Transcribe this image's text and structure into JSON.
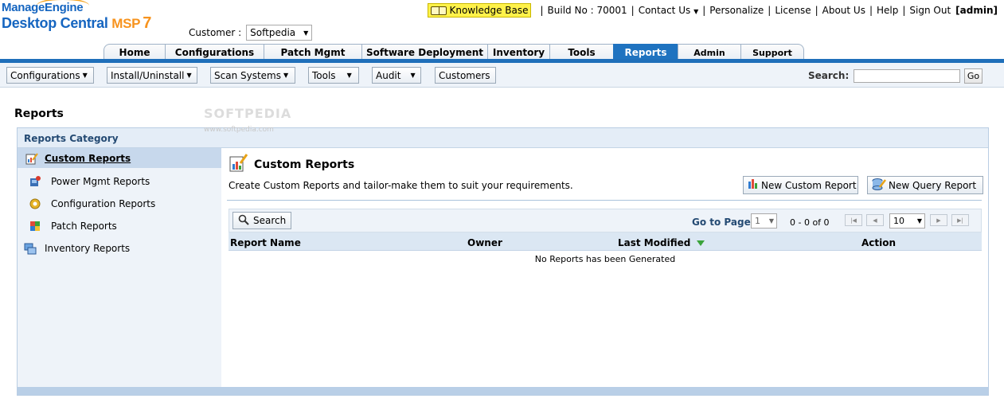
{
  "logo": {
    "brand": "ManageEngine",
    "product": "Desktop Central",
    "edition": "MSP",
    "version": "7"
  },
  "customer": {
    "label": "Customer :",
    "selected": "Softpedia"
  },
  "top_links": {
    "knowledge_base": "Knowledge Base",
    "build": "Build No : 70001",
    "contact_us": "Contact Us",
    "personalize": "Personalize",
    "license": "License",
    "about_us": "About Us",
    "help": "Help",
    "sign_out": "Sign Out",
    "user": "[admin]"
  },
  "tabs": [
    {
      "label": "Home"
    },
    {
      "label": "Configurations"
    },
    {
      "label": "Patch Mgmt"
    },
    {
      "label": "Software Deployment"
    },
    {
      "label": "Inventory"
    },
    {
      "label": "Tools"
    },
    {
      "label": "Reports",
      "active": true
    },
    {
      "label": "Admin"
    },
    {
      "label": "Support"
    }
  ],
  "toolbar": {
    "menus": [
      "Configurations",
      "Install/Uninstall",
      "Scan Systems",
      "Tools",
      "Audit",
      "Customers"
    ],
    "search_label": "Search:",
    "search_value": "",
    "go_label": "Go"
  },
  "page": {
    "title": "Reports"
  },
  "panel": {
    "header": "Reports Category",
    "categories": [
      {
        "label": "Custom Reports",
        "icon": "custom-reports-icon",
        "active": true
      },
      {
        "label": "Power Mgmt Reports",
        "icon": "power-mgmt-icon"
      },
      {
        "label": "Configuration Reports",
        "icon": "configuration-gear-icon"
      },
      {
        "label": "Patch Reports",
        "icon": "patch-icon"
      },
      {
        "label": "Inventory Reports",
        "icon": "inventory-icon"
      }
    ]
  },
  "content": {
    "title": "Custom Reports",
    "description": "Create Custom Reports and tailor-make them to suit your requirements.",
    "new_custom_report": "New Custom Report",
    "new_query_report": "New Query Report",
    "search_button": "Search",
    "goto_label": "Go to Page",
    "page_value": "1",
    "range_text": "0 - 0 of 0",
    "rows_per_page": "10",
    "columns": [
      "Report Name",
      "Owner",
      "Last Modified",
      "Action"
    ],
    "sorted_column": "Last Modified",
    "empty_message": "No Reports has been Generated"
  },
  "watermark": {
    "text": "SOFTPEDIA",
    "sub": "www.softpedia.com"
  },
  "colors": {
    "brand_blue": "#1565c0",
    "brand_orange": "#f7931e",
    "tab_active": "#1f73c0",
    "sidebar_bg": "#eef3f9",
    "kb_yellow": "#fff24a"
  }
}
